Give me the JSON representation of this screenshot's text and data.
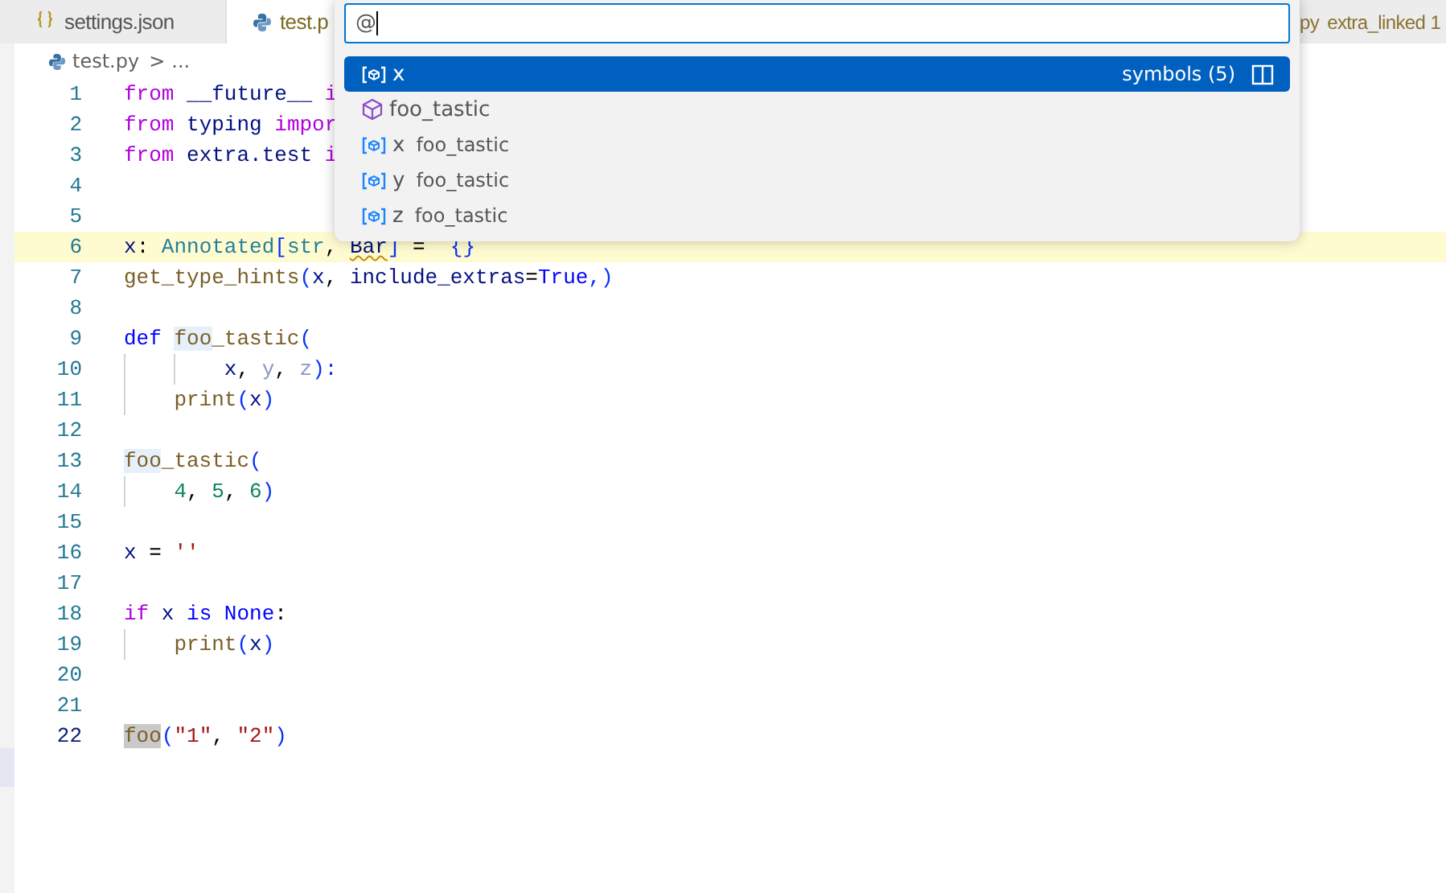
{
  "tabs": [
    {
      "label": "settings.json",
      "selected": false
    },
    {
      "label": "test.p",
      "selected": true
    }
  ],
  "right_tab": {
    "label": "extra_linked 1",
    "prefix": "py"
  },
  "breadcrumb": {
    "file": "test.py",
    "separator": ">",
    "rest": "..."
  },
  "quick_pick": {
    "value": "@",
    "items": [
      {
        "kind": "variable",
        "label": "x",
        "selected": true,
        "group_label": "symbols (5)"
      },
      {
        "kind": "module",
        "label": "foo_tastic",
        "selected": false
      },
      {
        "kind": "variable",
        "label": "x",
        "description": "foo_tastic",
        "selected": false
      },
      {
        "kind": "variable",
        "label": "y",
        "description": "foo_tastic",
        "selected": false
      },
      {
        "kind": "variable",
        "label": "z",
        "description": "foo_tastic",
        "selected": false
      }
    ]
  },
  "lines": [
    {
      "number": "1",
      "tokens": [
        {
          "text": "from",
          "kind": "kw"
        },
        {
          "text": " __future__ ",
          "kind": "name"
        },
        {
          "text": "i",
          "kind": "kw"
        }
      ]
    },
    {
      "number": "2",
      "tokens": [
        {
          "text": "from",
          "kind": "kw"
        },
        {
          "text": " typing ",
          "kind": "name"
        },
        {
          "text": "impor",
          "kind": "kw"
        }
      ]
    },
    {
      "number": "3",
      "tokens": [
        {
          "text": "from",
          "kind": "kw"
        },
        {
          "text": " extra.test ",
          "kind": "name"
        },
        {
          "text": "i",
          "kind": "kw"
        }
      ]
    },
    {
      "number": "4"
    },
    {
      "number": "5"
    },
    {
      "number": "6",
      "current": true,
      "tokens": [
        {
          "text": "x",
          "kind": "name"
        },
        {
          "text": ": ",
          "kind": "op"
        },
        {
          "text": "Annotated",
          "kind": "type"
        },
        {
          "text": "[",
          "kind": "br1"
        },
        {
          "text": "str",
          "kind": "type"
        },
        {
          "text": ", ",
          "kind": "op"
        },
        {
          "text": "Bar",
          "kind": "name",
          "squiggle": true
        },
        {
          "text": "]",
          "kind": "br1"
        },
        {
          "text": " =  ",
          "kind": "op"
        },
        {
          "text": "{}",
          "kind": "br1"
        }
      ]
    },
    {
      "number": "7",
      "tokens": [
        {
          "text": "get_type_hints",
          "kind": "func"
        },
        {
          "text": "(",
          "kind": "br1"
        },
        {
          "text": "x",
          "kind": "name"
        },
        {
          "text": ", ",
          "kind": "op"
        },
        {
          "text": "include_extras",
          "kind": "name"
        },
        {
          "text": "=",
          "kind": "op"
        },
        {
          "text": "True",
          "kind": "const"
        },
        {
          "text": ",)",
          "kind": "br1"
        }
      ]
    },
    {
      "number": "8"
    },
    {
      "number": "9",
      "tokens": [
        {
          "text": "def ",
          "kind": "const"
        },
        {
          "text": "foo",
          "kind": "func",
          "highlighted": true
        },
        {
          "text": "_tastic",
          "kind": "func"
        },
        {
          "text": "(",
          "kind": "br1"
        }
      ]
    },
    {
      "number": "10",
      "tokens": [
        {
          "text": "        x",
          "kind": "name"
        },
        {
          "text": ", ",
          "kind": "op"
        },
        {
          "text": "y",
          "kind": "dim"
        },
        {
          "text": ", ",
          "kind": "op"
        },
        {
          "text": "z",
          "kind": "dim"
        },
        {
          "text": "):",
          "kind": "br1"
        }
      ]
    },
    {
      "number": "11",
      "tokens": [
        {
          "text": "    print",
          "kind": "func"
        },
        {
          "text": "(",
          "kind": "br1"
        },
        {
          "text": "x",
          "kind": "name"
        },
        {
          "text": ")",
          "kind": "br1"
        }
      ]
    },
    {
      "number": "12"
    },
    {
      "number": "13",
      "tokens": [
        {
          "text": "foo",
          "kind": "func",
          "highlighted": true
        },
        {
          "text": "_tastic",
          "kind": "func"
        },
        {
          "text": "(",
          "kind": "br1"
        }
      ]
    },
    {
      "number": "14",
      "tokens": [
        {
          "text": "    4",
          "kind": "num"
        },
        {
          "text": ", ",
          "kind": "op"
        },
        {
          "text": "5",
          "kind": "num"
        },
        {
          "text": ", ",
          "kind": "op"
        },
        {
          "text": "6",
          "kind": "num"
        },
        {
          "text": ")",
          "kind": "br1"
        }
      ]
    },
    {
      "number": "15"
    },
    {
      "number": "16",
      "tokens": [
        {
          "text": "x",
          "kind": "name"
        },
        {
          "text": " = ",
          "kind": "op"
        },
        {
          "text": "''",
          "kind": "str"
        }
      ]
    },
    {
      "number": "17"
    },
    {
      "number": "18",
      "tokens": [
        {
          "text": "if",
          "kind": "kw"
        },
        {
          "text": " x ",
          "kind": "name"
        },
        {
          "text": "is None",
          "kind": "const"
        },
        {
          "text": ":",
          "kind": "op"
        }
      ]
    },
    {
      "number": "19",
      "tokens": [
        {
          "text": "    print",
          "kind": "func"
        },
        {
          "text": "(",
          "kind": "br1"
        },
        {
          "text": "x",
          "kind": "name"
        },
        {
          "text": ")",
          "kind": "br1"
        }
      ]
    },
    {
      "number": "20"
    },
    {
      "number": "21"
    },
    {
      "number": "22",
      "active": true,
      "tokens": [
        {
          "text": "foo",
          "kind": "func",
          "selected": true
        },
        {
          "text": "(",
          "kind": "br1"
        },
        {
          "text": "\"1\"",
          "kind": "str"
        },
        {
          "text": ", ",
          "kind": "op"
        },
        {
          "text": "\"2\"",
          "kind": "str"
        },
        {
          "text": ")",
          "kind": "br1"
        }
      ]
    }
  ]
}
